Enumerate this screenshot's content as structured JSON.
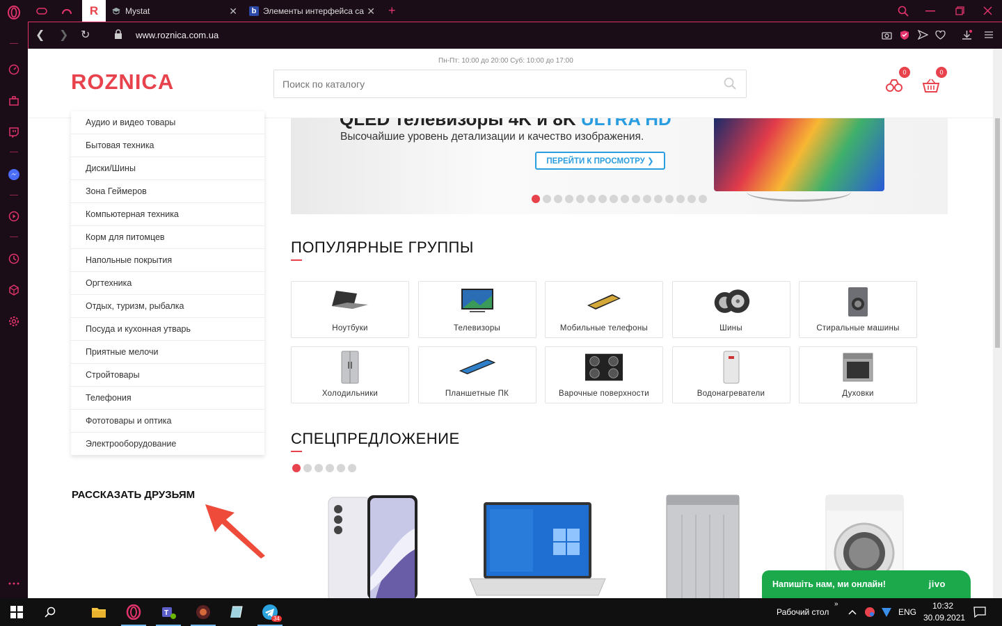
{
  "browser": {
    "tabs": [
      {
        "label": "",
        "icon": "opera-r-icon"
      },
      {
        "label": "Mystat",
        "icon": "mortarboard-icon"
      },
      {
        "label": "Элементы интерфейса са",
        "icon": "b-icon"
      }
    ],
    "new_tab_symbol": "+",
    "url": "www.roznica.com.ua"
  },
  "site": {
    "work_hours": "Пн-Пт: 10:00 до 20:00 Суб: 10:00 до 17:00",
    "logo": "ROZNICA",
    "search_placeholder": "Поиск по каталогу",
    "compare_count": "0",
    "cart_count": "0",
    "categories": [
      "Аудио и видео товары",
      "Бытовая техника",
      "Диски/Шины",
      "Зона Геймеров",
      "Компьютерная техника",
      "Корм для питомцев",
      "Напольные покрытия",
      "Оргтехника",
      "Отдых, туризм, рыбалка",
      "Посуда и кухонная утварь",
      "Приятные мелочи",
      "Стройтовары",
      "Телефония",
      "Фототовары и оптика",
      "Электрооборудование"
    ],
    "tell_friends": "РАССКАЗАТЬ ДРУЗЬЯМ",
    "banner": {
      "title": "QLED телевизоры 4K и 8K",
      "title_accent": "ULTRA HD",
      "subtitle": "Высочайшие уровень детализации и качество изображения.",
      "button": "ПЕРЕЙТИ К ПРОСМОТРУ ❯",
      "dot_count": 16,
      "active_dot": 0
    },
    "popular_title": "ПОПУЛЯРНЫЕ ГРУППЫ",
    "groups": [
      {
        "label": "Ноутбуки",
        "icon": "laptop-icon"
      },
      {
        "label": "Телевизоры",
        "icon": "tv-icon"
      },
      {
        "label": "Мобильные телефоны",
        "icon": "phone-icon"
      },
      {
        "label": "Шины",
        "icon": "tire-icon"
      },
      {
        "label": "Стиральные машины",
        "icon": "washer-icon"
      },
      {
        "label": "Холодильники",
        "icon": "fridge-icon"
      },
      {
        "label": "Планшетные ПК",
        "icon": "tablet-icon"
      },
      {
        "label": "Варочные поверхности",
        "icon": "cooktop-icon"
      },
      {
        "label": "Водонагреватели",
        "icon": "water-heater-icon"
      },
      {
        "label": "Духовки",
        "icon": "oven-icon"
      }
    ],
    "special_title": "СПЕЦПРЕДЛОЖЕНИЕ",
    "special_dot_count": 6,
    "special_active_dot": 0,
    "chat_message": "Напишіть нам, ми онлайн!",
    "chat_brand": "jivo"
  },
  "taskbar": {
    "desktop_label": "Рабочий стол",
    "language": "ENG",
    "time": "10:32",
    "date": "30.09.2021",
    "telegram_badge": "34"
  }
}
